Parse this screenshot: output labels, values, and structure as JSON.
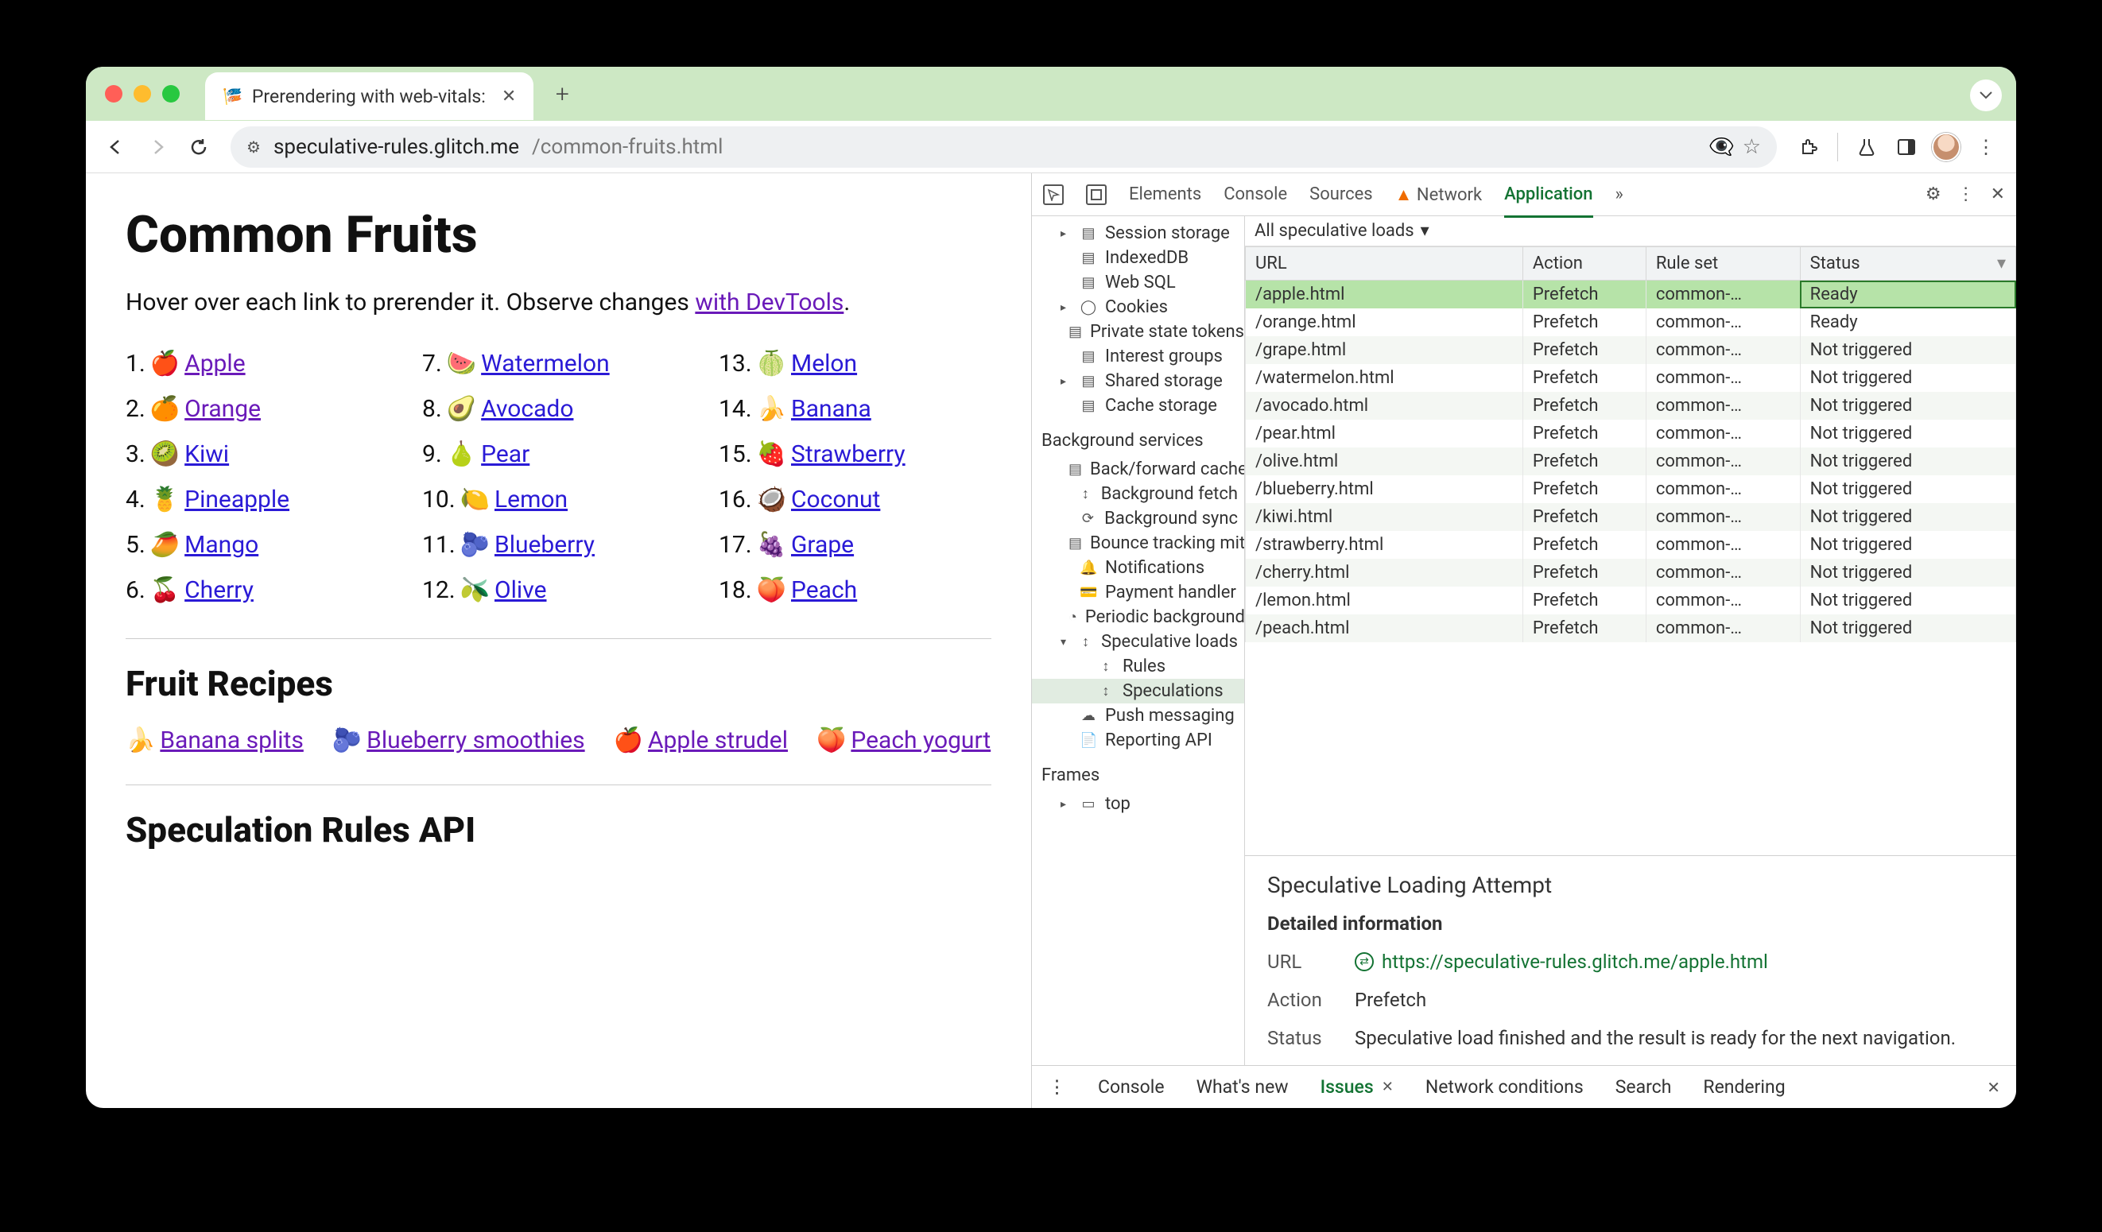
{
  "tab": {
    "title": "Prerendering with web-vitals:"
  },
  "url": {
    "security": "⚙",
    "host": "speculative-rules.glitch.me",
    "path": "/common-fruits.html"
  },
  "page": {
    "h1": "Common Fruits",
    "intro_prefix": "Hover over each link to prerender it. Observe changes ",
    "intro_link": "with DevTools",
    "intro_suffix": ".",
    "fruits": [
      {
        "n": "1.",
        "e": "🍎",
        "t": "Apple",
        "visited": true
      },
      {
        "n": "2.",
        "e": "🍊",
        "t": "Orange",
        "visited": true
      },
      {
        "n": "3.",
        "e": "🥝",
        "t": "Kiwi"
      },
      {
        "n": "4.",
        "e": "🍍",
        "t": "Pineapple"
      },
      {
        "n": "5.",
        "e": "🥭",
        "t": "Mango"
      },
      {
        "n": "6.",
        "e": "🍒",
        "t": "Cherry"
      },
      {
        "n": "7.",
        "e": "🍉",
        "t": "Watermelon"
      },
      {
        "n": "8.",
        "e": "🥑",
        "t": "Avocado"
      },
      {
        "n": "9.",
        "e": "🍐",
        "t": "Pear"
      },
      {
        "n": "10.",
        "e": "🍋",
        "t": "Lemon"
      },
      {
        "n": "11.",
        "e": "🫐",
        "t": "Blueberry"
      },
      {
        "n": "12.",
        "e": "🫒",
        "t": "Olive"
      },
      {
        "n": "13.",
        "e": "🍈",
        "t": "Melon"
      },
      {
        "n": "14.",
        "e": "🍌",
        "t": "Banana"
      },
      {
        "n": "15.",
        "e": "🍓",
        "t": "Strawberry"
      },
      {
        "n": "16.",
        "e": "🥥",
        "t": "Coconut"
      },
      {
        "n": "17.",
        "e": "🍇",
        "t": "Grape"
      },
      {
        "n": "18.",
        "e": "🍑",
        "t": "Peach"
      }
    ],
    "h2_recipes": "Fruit Recipes",
    "recipes": [
      {
        "e": "🍌",
        "t": "Banana splits",
        "visited": true
      },
      {
        "e": "🫐",
        "t": "Blueberry smoothies",
        "visited": true
      },
      {
        "e": "🍎",
        "t": "Apple strudel",
        "visited": true
      },
      {
        "e": "🍑",
        "t": "Peach yogurt",
        "visited": true
      }
    ],
    "h2_api": "Speculation Rules API"
  },
  "devtools": {
    "tabs": {
      "elements": "Elements",
      "console": "Console",
      "sources": "Sources",
      "network": "Network",
      "application": "Application",
      "more": "»"
    },
    "side_storage": [
      {
        "t": "Session storage",
        "i": "▤",
        "d": true
      },
      {
        "t": "IndexedDB",
        "i": "▤"
      },
      {
        "t": "Web SQL",
        "i": "▤"
      },
      {
        "t": "Cookies",
        "i": "◯",
        "d": true
      },
      {
        "t": "Private state tokens",
        "i": "▤"
      },
      {
        "t": "Interest groups",
        "i": "▤"
      },
      {
        "t": "Shared storage",
        "i": "▤",
        "d": true
      },
      {
        "t": "Cache storage",
        "i": "▤"
      }
    ],
    "side_bg_label": "Background services",
    "side_bg": [
      {
        "t": "Back/forward cache",
        "i": "▤"
      },
      {
        "t": "Background fetch",
        "i": "↕"
      },
      {
        "t": "Background sync",
        "i": "⟳"
      },
      {
        "t": "Bounce tracking mitigation",
        "i": "▤"
      },
      {
        "t": "Notifications",
        "i": "🔔"
      },
      {
        "t": "Payment handler",
        "i": "💳"
      },
      {
        "t": "Periodic background sync",
        "i": "◔"
      },
      {
        "t": "Speculative loads",
        "i": "↕",
        "d": true,
        "open": true
      },
      {
        "t": "Rules",
        "i": "↕",
        "sub": true
      },
      {
        "t": "Speculations",
        "i": "↕",
        "sub": true,
        "sel": true
      },
      {
        "t": "Push messaging",
        "i": "☁"
      },
      {
        "t": "Reporting API",
        "i": "📄"
      }
    ],
    "side_frames_label": "Frames",
    "side_frames": [
      {
        "t": "top",
        "i": "▭",
        "d": true
      }
    ],
    "filter": "All speculative loads",
    "cols": {
      "url": "URL",
      "action": "Action",
      "ruleset": "Rule set",
      "status": "Status"
    },
    "rows": [
      {
        "u": "/apple.html",
        "a": "Prefetch",
        "r": "common-…",
        "s": "Ready",
        "sel": true
      },
      {
        "u": "/orange.html",
        "a": "Prefetch",
        "r": "common-…",
        "s": "Ready"
      },
      {
        "u": "/grape.html",
        "a": "Prefetch",
        "r": "common-…",
        "s": "Not triggered"
      },
      {
        "u": "/watermelon.html",
        "a": "Prefetch",
        "r": "common-…",
        "s": "Not triggered"
      },
      {
        "u": "/avocado.html",
        "a": "Prefetch",
        "r": "common-…",
        "s": "Not triggered"
      },
      {
        "u": "/pear.html",
        "a": "Prefetch",
        "r": "common-…",
        "s": "Not triggered"
      },
      {
        "u": "/olive.html",
        "a": "Prefetch",
        "r": "common-…",
        "s": "Not triggered"
      },
      {
        "u": "/blueberry.html",
        "a": "Prefetch",
        "r": "common-…",
        "s": "Not triggered"
      },
      {
        "u": "/kiwi.html",
        "a": "Prefetch",
        "r": "common-…",
        "s": "Not triggered"
      },
      {
        "u": "/strawberry.html",
        "a": "Prefetch",
        "r": "common-…",
        "s": "Not triggered"
      },
      {
        "u": "/cherry.html",
        "a": "Prefetch",
        "r": "common-…",
        "s": "Not triggered"
      },
      {
        "u": "/lemon.html",
        "a": "Prefetch",
        "r": "common-…",
        "s": "Not triggered"
      },
      {
        "u": "/peach.html",
        "a": "Prefetch",
        "r": "common-…",
        "s": "Not triggered"
      }
    ],
    "detail": {
      "title": "Speculative Loading Attempt",
      "heading": "Detailed information",
      "url_k": "URL",
      "url_v": "https://speculative-rules.glitch.me/apple.html",
      "action_k": "Action",
      "action_v": "Prefetch",
      "status_k": "Status",
      "status_v": "Speculative load finished and the result is ready for the next navigation."
    },
    "drawer": {
      "menu": "⋮",
      "console": "Console",
      "whatsnew": "What's new",
      "issues": "Issues",
      "netcond": "Network conditions",
      "search": "Search",
      "rendering": "Rendering"
    }
  }
}
